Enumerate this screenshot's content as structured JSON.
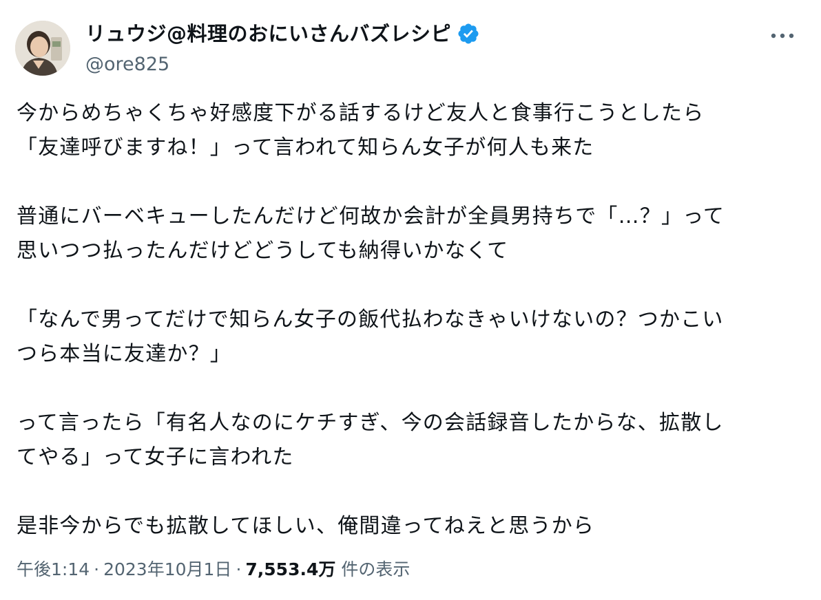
{
  "author": {
    "display_name": "リュウジ@料理のおにいさんバズレシピ",
    "handle": "@ore825",
    "verified": true,
    "verified_icon": "verified-badge-icon",
    "verified_color": "#1d9bf0"
  },
  "more_icon": "more-options-icon",
  "tweet": {
    "paragraphs": [
      [
        "今からめちゃくちゃ好感度下がる話するけど友人と食事行こうとしたら",
        "「友達呼びますね！」って言われて知らん女子が何人も来た"
      ],
      [
        "普通にバーベキューしたんだけど何故か会計が全員男持ちで「…？」って",
        "思いつつ払ったんだけどどうしても納得いかなくて"
      ],
      [
        "「なんで男ってだけで知らん女子の飯代払わなきゃいけないの？つかこい",
        "つら本当に友達か？」"
      ],
      [
        "って言ったら「有名人なのにケチすぎ、今の会話録音したからな、拡散し",
        "てやる」って女子に言われた"
      ],
      [
        "是非今からでも拡散してほしい、俺間違ってねえと思うから"
      ]
    ]
  },
  "meta": {
    "time": "午後1:14",
    "date": "2023年10月1日",
    "separator": "·",
    "views_count": "7,553.4万",
    "views_label": "件の表示"
  },
  "colors": {
    "text_primary": "#0f1419",
    "text_secondary": "#536471",
    "background": "#ffffff"
  }
}
